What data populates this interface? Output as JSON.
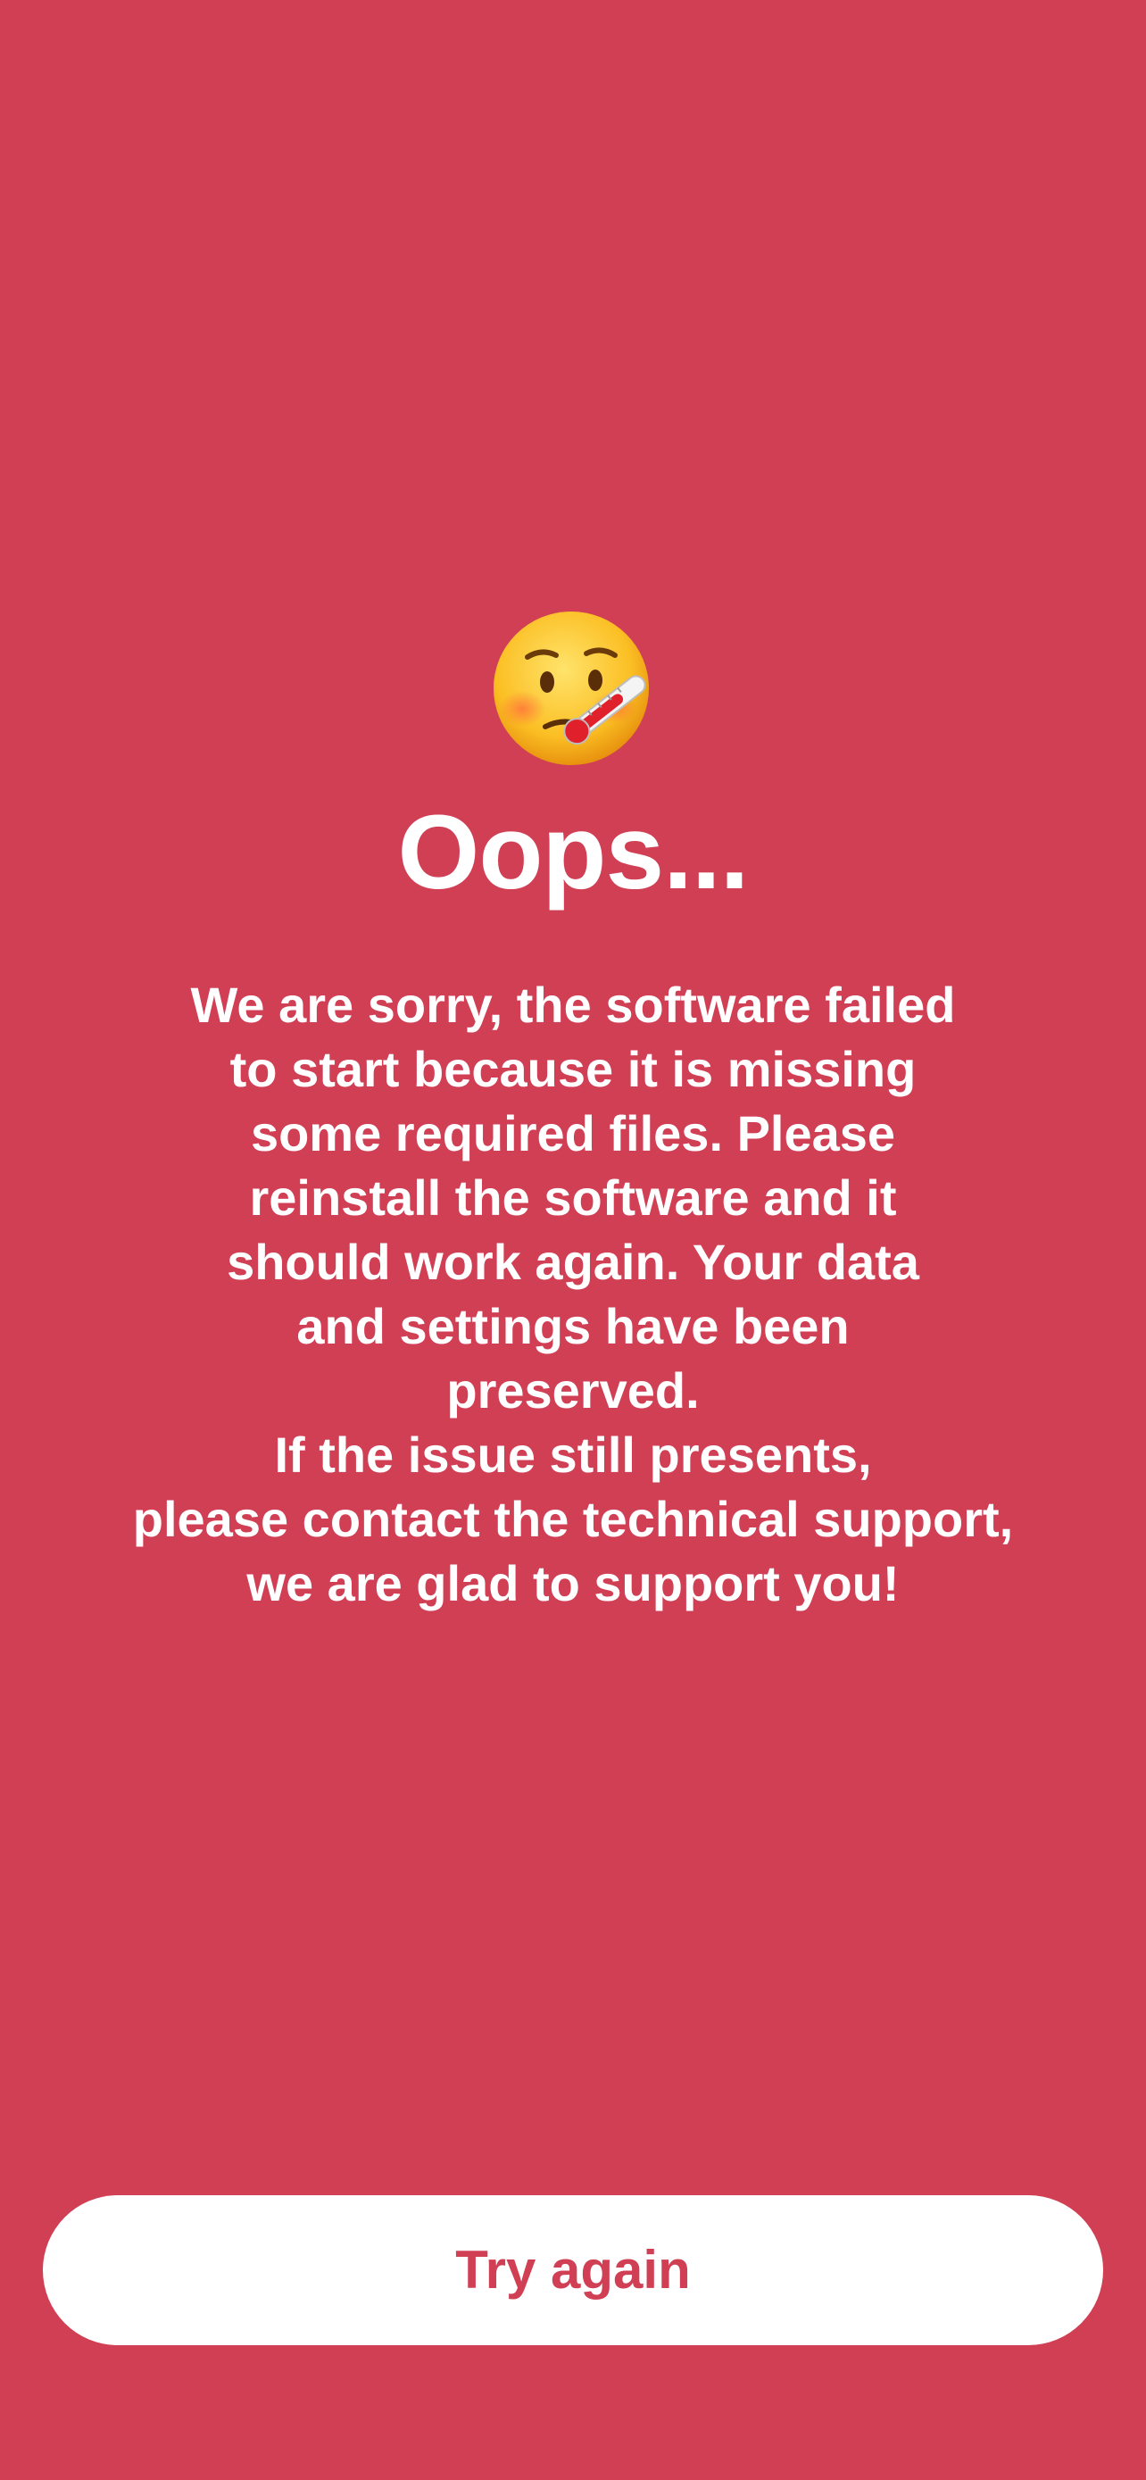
{
  "colors": {
    "background": "#d13f55",
    "text": "#ffffff",
    "button_background": "#ffffff",
    "button_text": "#d13f55"
  },
  "icon": {
    "name": "face-with-thermometer-icon"
  },
  "title": "Oops...",
  "message_lines": [
    "We are sorry, the software failed",
    "to start because it is missing",
    "some required files. Please",
    "reinstall the software and it",
    "should work again. Your data",
    "and settings have been",
    "preserved.",
    "If the issue still presents,",
    "please contact the technical support,",
    "we are glad to support you!"
  ],
  "button": {
    "label": "Try again"
  }
}
